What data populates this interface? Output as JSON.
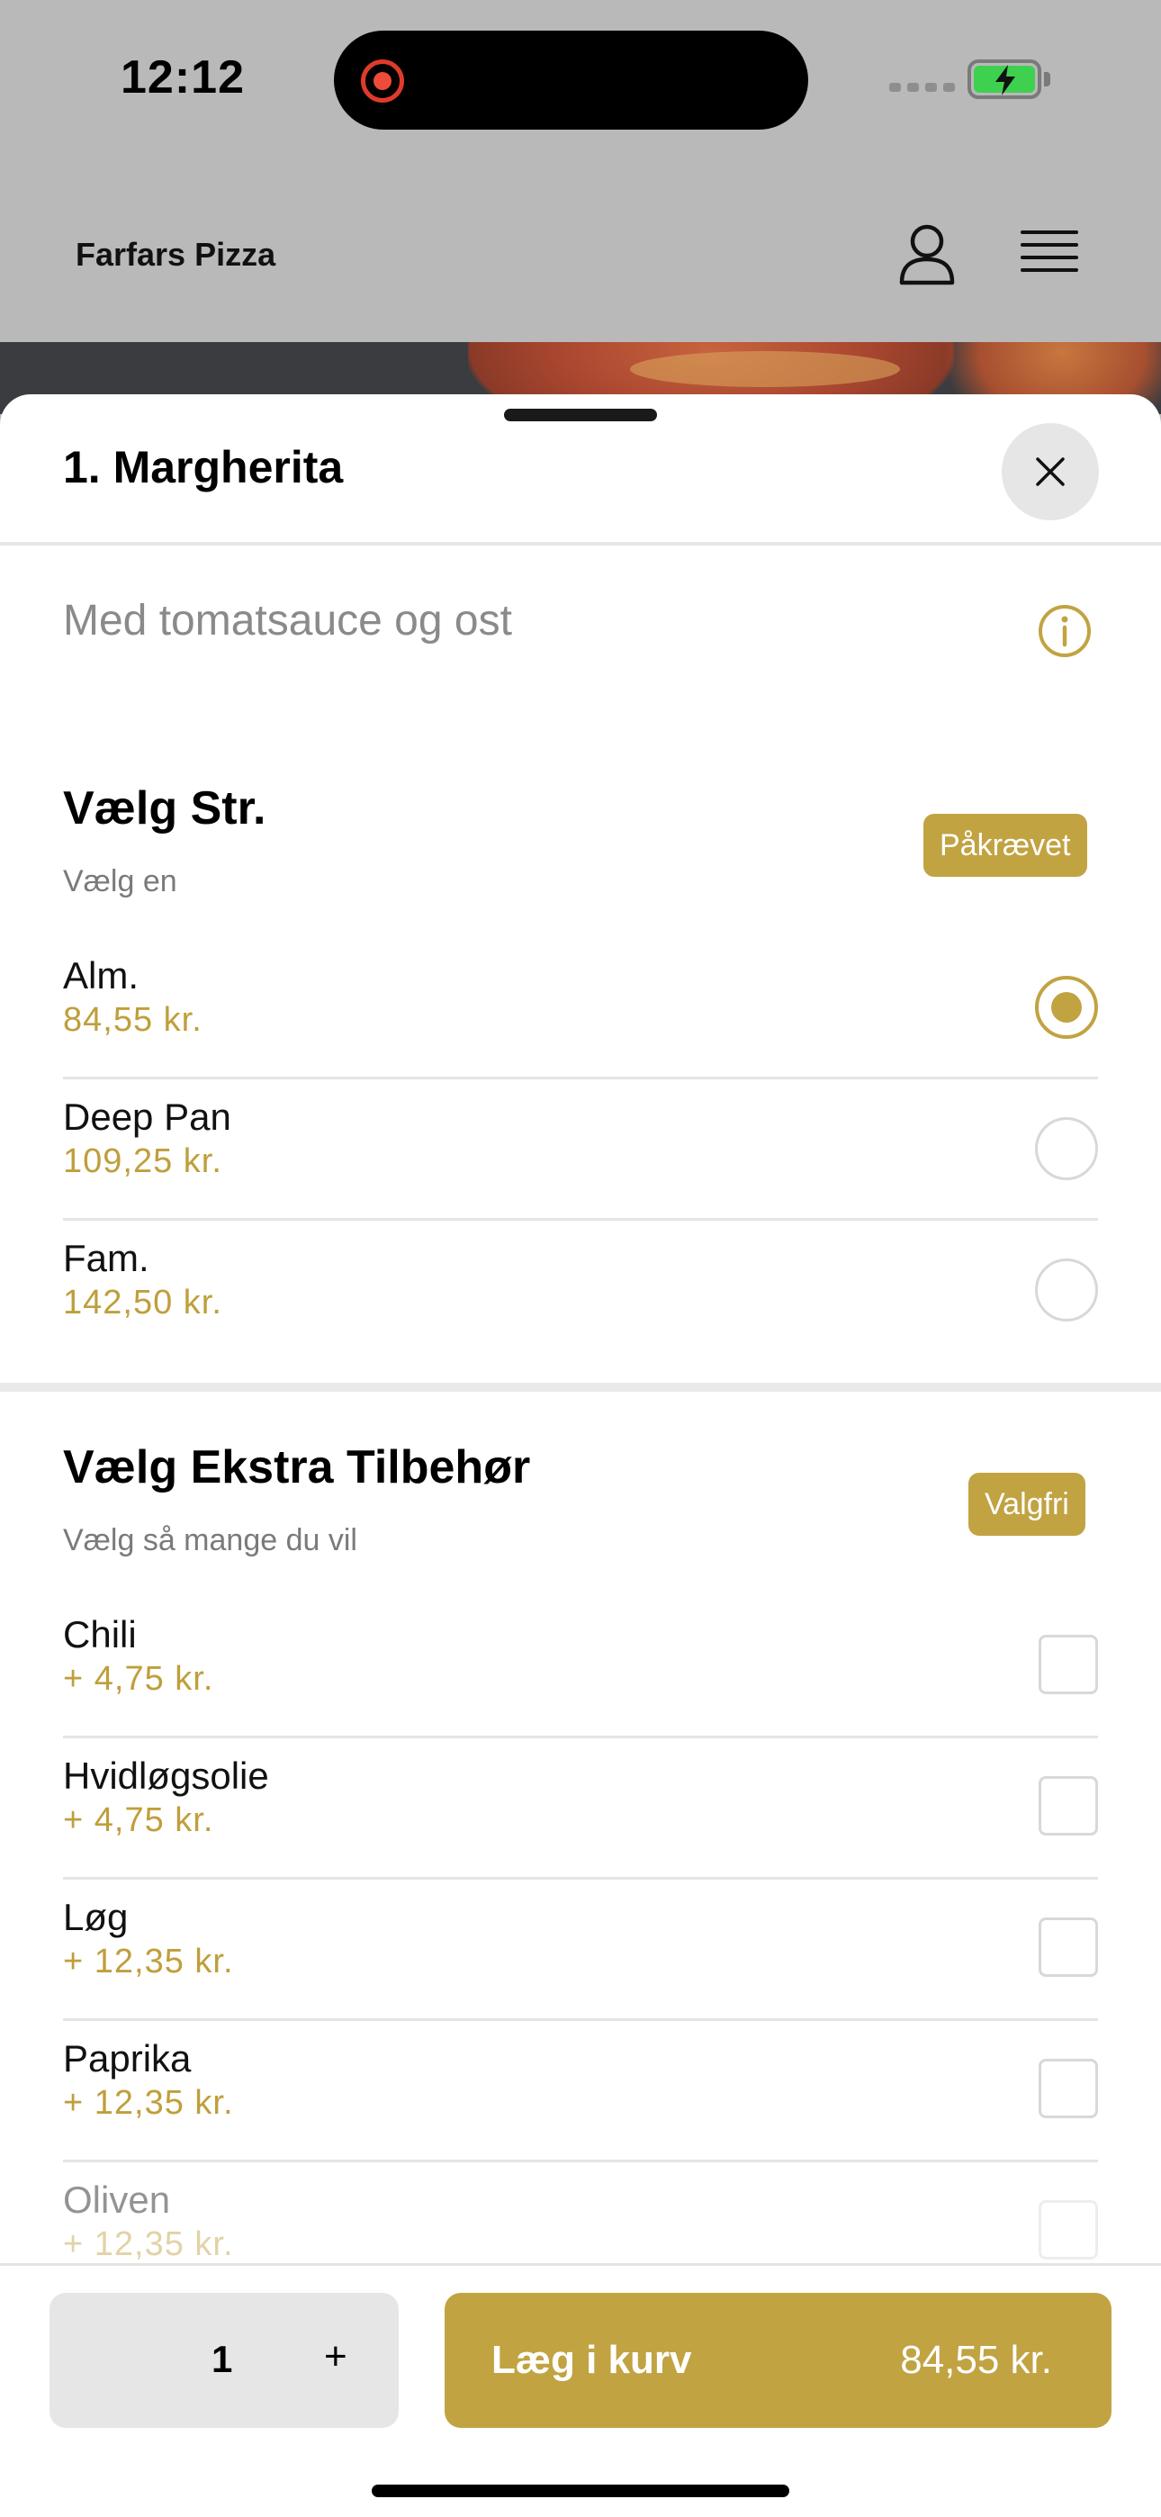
{
  "status_bar": {
    "time": "12:12"
  },
  "header": {
    "brand": "Farfars Pizza"
  },
  "sheet": {
    "title": "1. Margherita",
    "description": "Med tomatsauce og ost"
  },
  "size_section": {
    "title": "Vælg Str.",
    "subtitle": "Vælg en",
    "badge": "Påkrævet",
    "options": [
      {
        "label": "Alm.",
        "price": "84,55 kr.",
        "selected": true
      },
      {
        "label": "Deep Pan",
        "price": "109,25 kr.",
        "selected": false
      },
      {
        "label": "Fam.",
        "price": "142,50 kr.",
        "selected": false
      }
    ]
  },
  "extras_section": {
    "title": "Vælg Ekstra Tilbehør",
    "subtitle": "Vælg så mange du vil",
    "badge": "Valgfri",
    "options": [
      {
        "label": "Chili",
        "price": "+ 4,75 kr."
      },
      {
        "label": "Hvidløgsolie",
        "price": "+ 4,75 kr."
      },
      {
        "label": "Løg",
        "price": "+ 12,35 kr."
      },
      {
        "label": "Paprika",
        "price": "+ 12,35 kr."
      },
      {
        "label": "Oliven",
        "price": "+ 12,35 kr."
      }
    ]
  },
  "bottom_bar": {
    "quantity": "1",
    "plus": "+",
    "add_label": "Læg i kurv",
    "total": "84,55 kr."
  },
  "colors": {
    "accent": "#c1a342",
    "price": "#bf9f3c"
  }
}
